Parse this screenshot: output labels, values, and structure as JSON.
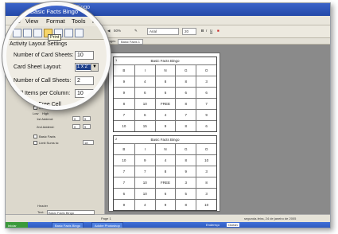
{
  "window": {
    "title": "Basic Facts Bingo",
    "menu": [
      "File",
      "View",
      "Format",
      "Tools",
      "Help"
    ]
  },
  "toolbar": {
    "tooltip": "Print",
    "zoom": "50%",
    "font": "Arial",
    "font_size": "20"
  },
  "tabs": {
    "pages_label": "Pages",
    "active_tab": "Basic Facts 1"
  },
  "panel": {
    "header": "Activity Layout Settings",
    "number_of_card_sheets_label": "Number of Card Sheets:",
    "number_of_card_sheets": "10",
    "card_sheet_layout_label": "Card Sheet Layout:",
    "card_sheet_layout": "1 x 2",
    "number_of_call_sheets_label": "Number of Call Sheets:",
    "number_of_call_sheets": "2",
    "call_items_per_column_label": "Call Items per Column:",
    "call_items_per_column": "10",
    "use_free_cell_label": "Use Free Cell",
    "include_addition_label": "Include Addition",
    "low_label": "Low",
    "high_label": "High",
    "first_addend_label": "1st Addend:",
    "first_addend_low": "0",
    "first_addend_high": "9",
    "second_addend_label": "2nd Addend:",
    "second_addend_low": "0",
    "second_addend_high": "9",
    "basic_facts_label": "Basic Facts",
    "limit_sums_label": "Limit Sums to:",
    "limit_sums_value": "18"
  },
  "document": {
    "card_title": "Basic Facts Bingo",
    "cards": [
      {
        "number": "1",
        "rows": [
          [
            "B",
            "I",
            "N",
            "G",
            "O"
          ],
          [
            "9",
            "4",
            "8",
            "8",
            "3"
          ],
          [
            "9",
            "6",
            "6",
            "6",
            "6"
          ],
          [
            "8",
            "10",
            "FREE",
            "8",
            "7"
          ],
          [
            "7",
            "6",
            "4",
            "7",
            "9"
          ],
          [
            "10",
            "15",
            "9",
            "8",
            "6"
          ]
        ]
      },
      {
        "number": "2",
        "rows": [
          [
            "B",
            "I",
            "N",
            "G",
            "O"
          ],
          [
            "10",
            "9",
            "4",
            "8",
            "10"
          ],
          [
            "7",
            "7",
            "8",
            "9",
            "3"
          ],
          [
            "7",
            "10",
            "FREE",
            "3",
            "8"
          ],
          [
            "6",
            "10",
            "6",
            "5",
            "3"
          ],
          [
            "9",
            "4",
            "9",
            "8",
            "10"
          ]
        ]
      }
    ]
  },
  "status": {
    "header_label": "Header",
    "text_label": "Text:",
    "text_value": "Basic Facts Bingo",
    "page": "Page 1",
    "date": "segunda-feira, 24 de janeiro de 2005"
  },
  "taskbar": {
    "start": "Iniciar",
    "tasks": [
      "Basic Facts Bingo",
      "Adobe Photoshop"
    ],
    "zoom_label": "Endereço",
    "zoom_value": "Ocean"
  }
}
